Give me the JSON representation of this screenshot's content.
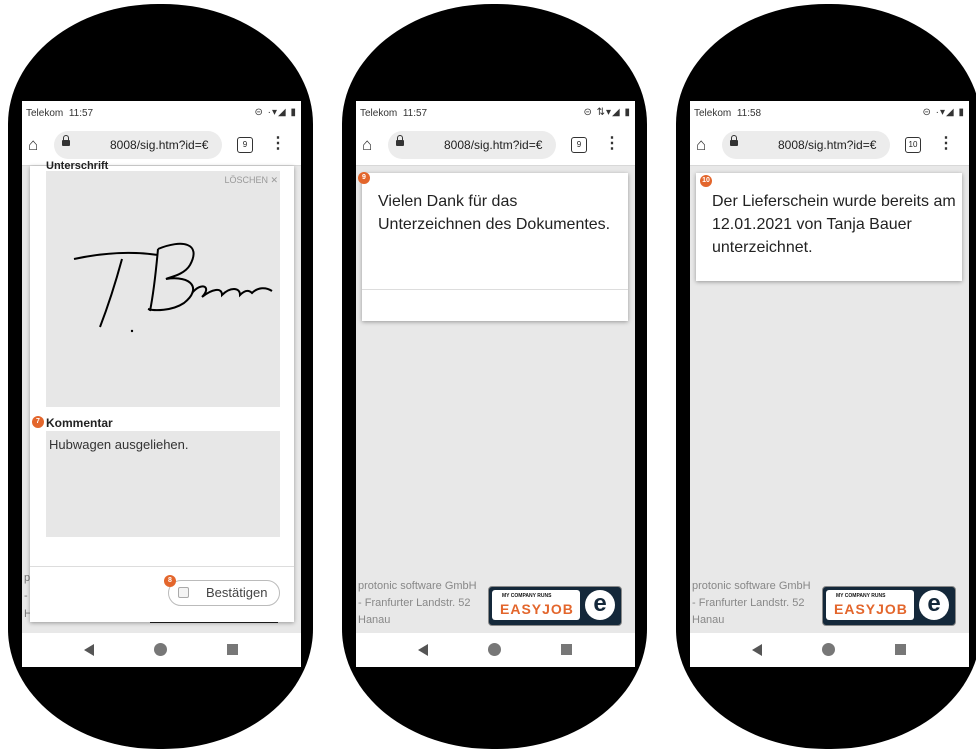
{
  "phones": [
    {
      "status": {
        "carrier": "Telekom",
        "time": "11:57",
        "icons": "⊝ ·▾◢ ▮"
      },
      "url": {
        "text": "8008/sig.htm?id=€",
        "tab_count": "9"
      },
      "signature_dialog": {
        "signature_label": "Unterschrift",
        "clear_label": "LÖSCHEN ✕",
        "signature_text": "T. Bauer",
        "marker_comment": "7",
        "comment_label": "Kommentar",
        "comment_value": "Hubwagen ausgeliehen.",
        "marker_confirm": "8",
        "confirm_label": "Bestätigen"
      },
      "background_peek": [
        "p",
        "-",
        "H"
      ]
    },
    {
      "status": {
        "carrier": "Telekom",
        "time": "11:57",
        "icons": "⊝ ⇅▾◢ ▮"
      },
      "url": {
        "text": "8008/sig.htm?id=€",
        "tab_count": "9"
      },
      "card": {
        "marker": "9",
        "message": "Vielen Dank für das Unterzeichnen des Dokumentes."
      },
      "footer": {
        "line1": "protonic software GmbH",
        "line2": "- Franfurter Landstr. 52",
        "line3": "Hanau"
      },
      "logo": {
        "small": "MY COMPANY RUNS",
        "big": "EASYJOB",
        "e": "e"
      }
    },
    {
      "status": {
        "carrier": "Telekom",
        "time": "11:58",
        "icons": "⊝ ·▾◢ ▮"
      },
      "url": {
        "text": "8008/sig.htm?id=€",
        "tab_count": "10"
      },
      "card": {
        "marker": "10",
        "message": "Der Lieferschein wurde bereits am 12.01.2021 von Tanja Bauer unterzeichnet."
      },
      "footer": {
        "line1": "protonic software GmbH",
        "line2": "- Franfurter Landstr. 52",
        "line3": "Hanau"
      },
      "logo": {
        "small": "MY COMPANY RUNS",
        "big": "EASYJOB",
        "e": "e"
      }
    }
  ],
  "icons": {
    "home": "home-icon",
    "lock": "lock-icon",
    "menu": "more-vert-icon",
    "back": "back-icon",
    "nav_home": "circle-home-icon",
    "recent": "recent-apps-icon"
  },
  "colors": {
    "marker": "#e3662c",
    "logo_bg": "#14283a"
  }
}
